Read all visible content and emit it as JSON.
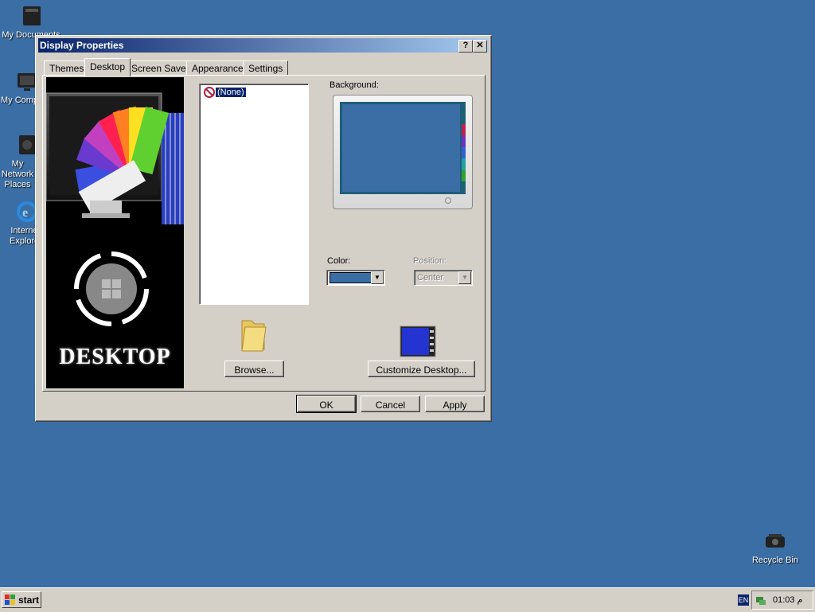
{
  "desktop": {
    "icons": [
      {
        "label": "My Documents"
      },
      {
        "label": "My Computer"
      },
      {
        "label": "My Network Places"
      },
      {
        "label": "Internet Explorer"
      },
      {
        "label": "Recycle Bin"
      }
    ]
  },
  "window": {
    "title": "Display Properties",
    "help_btn": "?",
    "close_btn": "✕",
    "tabs": [
      {
        "label": "Themes"
      },
      {
        "label": "Desktop"
      },
      {
        "label": "Screen Saver"
      },
      {
        "label": "Appearance"
      },
      {
        "label": "Settings"
      }
    ],
    "active_tab": "Desktop",
    "preview_art_text": "DESKTOP",
    "background_label": "Background:",
    "background_list": [
      {
        "label": "(None)"
      }
    ],
    "color_label": "Color:",
    "color_value": "#3a6ea5",
    "position_label": "Position:",
    "position_value": "Center",
    "browse_label": "Browse...",
    "customize_label": "Customize Desktop...",
    "ok_label": "OK",
    "cancel_label": "Cancel",
    "apply_label": "Apply"
  },
  "taskbar": {
    "start_label": "start",
    "lang": "EN",
    "clock": "01:03 م"
  },
  "colors": {
    "desktop_bg": "#3a6ea5",
    "titlebar_start": "#0a246a",
    "titlebar_end": "#a6caf0",
    "selection": "#0a246a"
  }
}
